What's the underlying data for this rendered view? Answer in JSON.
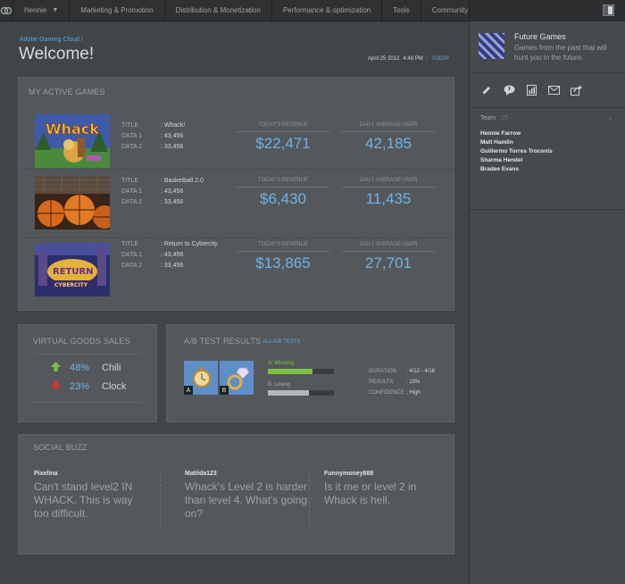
{
  "nav": {
    "user": "Hennie",
    "items": [
      "Marketing & Promotion",
      "Distribution & Monetization",
      "Performance & optimization",
      "Tools",
      "Community"
    ]
  },
  "header": {
    "breadcrumb": "Adobe Gaming Cloud",
    "breadcrumb_sep": "/",
    "title": "Welcome!",
    "date": "April 25 2012",
    "time": "4:48 PM",
    "pipe": "|",
    "today": "TODAY"
  },
  "games": {
    "title": "MY ACTIVE GAMES",
    "title_key": "TITLE",
    "data1_key": "DATA 1",
    "data2_key": "DATA 2",
    "revenue_label": "TODAY'S REVENUE",
    "users_label": "DAILY AVERAGE USER",
    "rows": [
      {
        "title": ": Whack!",
        "data1": ": 43,456",
        "data2": ": 33,456",
        "revenue": "$22,471",
        "users": "42,185"
      },
      {
        "title": ": Basketball 2.0",
        "data1": ": 43,456",
        "data2": ": 33,456",
        "revenue": "$6,430",
        "users": "11,435"
      },
      {
        "title": ": Return to Cybercity",
        "data1": ": 43,456",
        "data2": ": 33,456",
        "revenue": "$13,865",
        "users": "27,701"
      }
    ]
  },
  "virtual_goods": {
    "title": "VIRTUAL GOODS SALES",
    "items": [
      {
        "pct": "48%",
        "name": "Chili",
        "trend": "up"
      },
      {
        "pct": "23%",
        "name": "Clock",
        "trend": "down"
      }
    ]
  },
  "ab_test": {
    "title": "A/B TEST RESULTS",
    "link": "ALL A/B TESTS",
    "letter_a": "A",
    "letter_b": "B",
    "winning": "A:  Winning",
    "losing": "B:  Losing",
    "winning_level": 0.68,
    "losing_level": 0.62,
    "duration_key": "DURATION",
    "duration": ": 4/12 - 4/18",
    "results_key": "RESULTS",
    "results": ": 15%",
    "confidence_key": "CONFIDENCE",
    "confidence": ": High"
  },
  "buzz": {
    "title": "SOCIAL BUZZ",
    "posts": [
      {
        "user": "Pixelina",
        "text": "Can't stand level2 IN WHACK. This is way too difficult."
      },
      {
        "user": "Matilda123",
        "text": "Whack's Level 2 is harder than level 4. What's going on?"
      },
      {
        "user": "Funnymoney888",
        "text": "Is it me or level 2 in Whack is hell."
      }
    ]
  },
  "side": {
    "game_title": "Future Games",
    "game_desc": "Games from the past that will hunt you in the future.",
    "team_label": "Team",
    "team_count": ": 25",
    "members": [
      "Hennie Farrow",
      "Matt Hamlin",
      "Guillermo Torres Troconis",
      "Sharma Hendel",
      "Bradee Evans"
    ]
  },
  "colors": {
    "accent": "#6fb4e6",
    "link": "#5aa7e0",
    "up": "#7cc242",
    "down": "#d9342b"
  }
}
